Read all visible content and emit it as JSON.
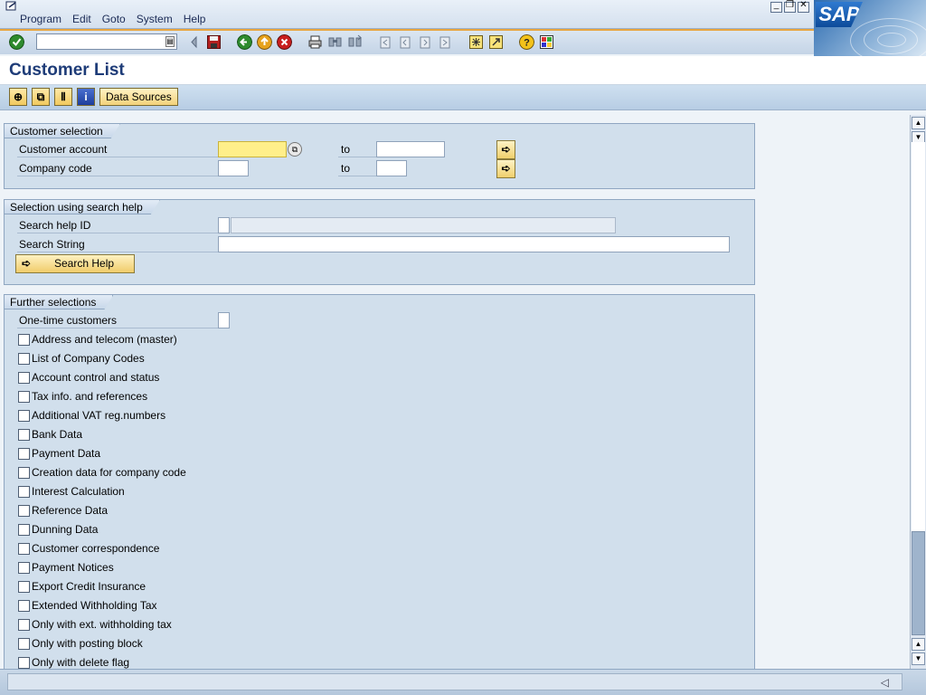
{
  "menubar": {
    "items": [
      "Program",
      "Edit",
      "Goto",
      "System",
      "Help"
    ],
    "window_controls": [
      "minimize-icon",
      "restore-icon",
      "close-icon"
    ]
  },
  "logo": {
    "text": "SAP"
  },
  "toolbar": {
    "command_value": "",
    "icons": [
      "enter-icon",
      "back-arrow-icon",
      "save-icon",
      "back-icon",
      "exit-icon",
      "cancel-icon",
      "print-icon",
      "find-icon",
      "find-next-icon",
      "first-page-icon",
      "previous-page-icon",
      "next-page-icon",
      "last-page-icon",
      "create-session-icon",
      "shortcut-icon",
      "help-icon",
      "layout-menu-icon"
    ]
  },
  "page": {
    "title": "Customer List"
  },
  "apptoolbar": {
    "data_sources_label": "Data Sources",
    "icons": [
      "execute-icon",
      "variants-icon",
      "selection-options-icon",
      "info-icon"
    ]
  },
  "customer_selection": {
    "title": "Customer selection",
    "rows": [
      {
        "label": "Customer account",
        "to": "to",
        "from_value": "",
        "to_value": ""
      },
      {
        "label": "Company code",
        "to": "to",
        "from_value": "",
        "to_value": ""
      }
    ]
  },
  "search_help": {
    "title": "Selection using search help",
    "search_help_id_label": "Search help ID",
    "search_string_label": "Search String",
    "button_label": "Search Help"
  },
  "further": {
    "title": "Further selections",
    "one_time_label": "One-time customers",
    "checkboxes": [
      "Address and telecom (master)",
      "List of Company Codes",
      "Account control and status",
      "Tax info. and references",
      "Additional VAT reg.numbers",
      "Bank Data",
      "Payment Data",
      "Creation data for company code",
      "Interest Calculation",
      "Reference Data",
      "Dunning Data",
      "Customer correspondence",
      "Payment Notices",
      "Export Credit Insurance",
      "Extended Withholding Tax",
      "Only with ext. withholding tax",
      "Only with posting block",
      "Only with delete flag"
    ]
  },
  "colors": {
    "accent": "#1e3c78",
    "toolbar_orange": "#e9a738",
    "panel": "#d1dfec",
    "highlight_field": "#ffef8a"
  }
}
